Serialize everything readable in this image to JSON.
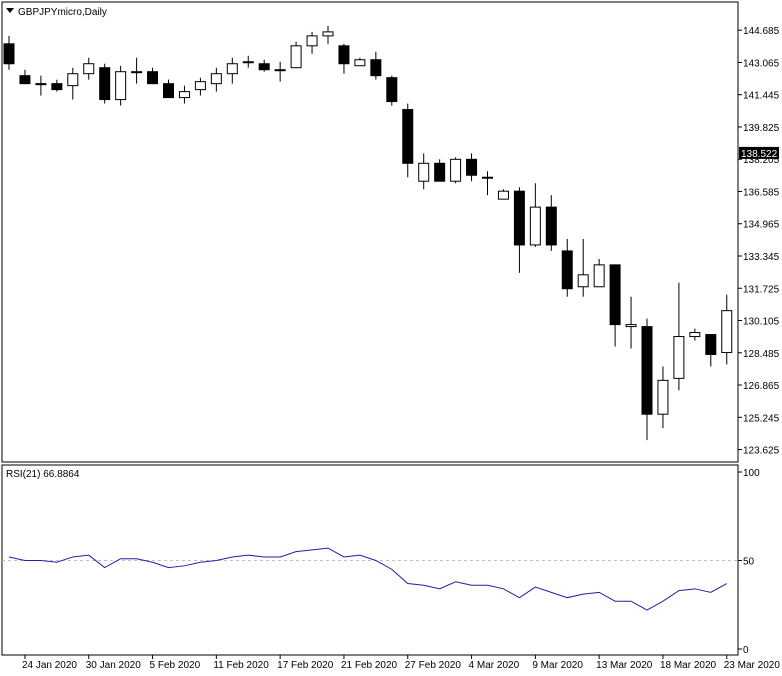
{
  "window": {
    "symbol_label": "GBPJPYmicro,Daily",
    "menu_arrow_icon": "triangle-down-icon"
  },
  "colors": {
    "background": "#ffffff",
    "frame": "#000000",
    "candle_bull_fill": "#ffffff",
    "candle_bear_fill": "#000000",
    "candle_outline": "#000000",
    "rsi_line": "#1f1fa8",
    "level_line": "#c0c0c0",
    "current_price_bg": "#000000",
    "current_price_text": "#ffffff"
  },
  "chart_data": [
    {
      "type": "candlestick",
      "title": "GBPJPYmicro,Daily",
      "ylim": [
        123.0,
        146.1
      ],
      "y_ticks": [
        "144.685",
        "143.065",
        "141.445",
        "139.825",
        "138.205",
        "136.585",
        "134.965",
        "133.345",
        "131.725",
        "130.105",
        "128.485",
        "126.865",
        "125.245",
        "123.625"
      ],
      "current_price": "138.522",
      "x_tick_labels": [
        "24 Jan 2020",
        "30 Jan 2020",
        "5 Feb 2020",
        "11 Feb 2020",
        "17 Feb 2020",
        "21 Feb 2020",
        "27 Feb 2020",
        "4 Mar 2020",
        "9 Mar 2020",
        "13 Mar 2020",
        "18 Mar 2020",
        "23 Mar 2020"
      ],
      "x_tick_indices": [
        1,
        5,
        9,
        13,
        17,
        21,
        25,
        29,
        33,
        37,
        41,
        45
      ],
      "candles": [
        {
          "o": 144.0,
          "h": 144.4,
          "l": 142.7,
          "c": 143.0
        },
        {
          "o": 142.4,
          "h": 142.7,
          "l": 142.0,
          "c": 142.0
        },
        {
          "o": 142.0,
          "h": 142.4,
          "l": 141.4,
          "c": 142.0
        },
        {
          "o": 142.0,
          "h": 142.2,
          "l": 141.6,
          "c": 141.7
        },
        {
          "o": 141.9,
          "h": 142.8,
          "l": 141.2,
          "c": 142.5
        },
        {
          "o": 142.5,
          "h": 143.3,
          "l": 142.2,
          "c": 143.0
        },
        {
          "o": 142.8,
          "h": 143.0,
          "l": 141.0,
          "c": 141.2
        },
        {
          "o": 141.2,
          "h": 142.9,
          "l": 140.9,
          "c": 142.6
        },
        {
          "o": 142.6,
          "h": 143.3,
          "l": 142.0,
          "c": 142.6
        },
        {
          "o": 142.6,
          "h": 142.8,
          "l": 142.0,
          "c": 142.0
        },
        {
          "o": 142.0,
          "h": 142.2,
          "l": 141.3,
          "c": 141.3
        },
        {
          "o": 141.3,
          "h": 141.9,
          "l": 141.0,
          "c": 141.6
        },
        {
          "o": 141.7,
          "h": 142.3,
          "l": 141.4,
          "c": 142.1
        },
        {
          "o": 142.0,
          "h": 142.8,
          "l": 141.6,
          "c": 142.5
        },
        {
          "o": 142.5,
          "h": 143.3,
          "l": 142.0,
          "c": 143.0
        },
        {
          "o": 143.1,
          "h": 143.4,
          "l": 142.8,
          "c": 143.1
        },
        {
          "o": 143.0,
          "h": 143.2,
          "l": 142.6,
          "c": 142.7
        },
        {
          "o": 142.7,
          "h": 143.1,
          "l": 142.1,
          "c": 142.7
        },
        {
          "o": 142.8,
          "h": 144.1,
          "l": 142.8,
          "c": 143.9
        },
        {
          "o": 143.9,
          "h": 144.6,
          "l": 143.5,
          "c": 144.4
        },
        {
          "o": 144.4,
          "h": 144.9,
          "l": 144.0,
          "c": 144.6
        },
        {
          "o": 143.9,
          "h": 144.0,
          "l": 142.5,
          "c": 143.0
        },
        {
          "o": 142.9,
          "h": 143.3,
          "l": 142.9,
          "c": 143.2
        },
        {
          "o": 143.2,
          "h": 143.6,
          "l": 142.2,
          "c": 142.4
        },
        {
          "o": 142.3,
          "h": 142.4,
          "l": 140.9,
          "c": 141.1
        },
        {
          "o": 140.7,
          "h": 141.0,
          "l": 137.3,
          "c": 138.0
        },
        {
          "o": 137.1,
          "h": 138.5,
          "l": 136.7,
          "c": 138.0
        },
        {
          "o": 138.0,
          "h": 138.2,
          "l": 137.1,
          "c": 137.1
        },
        {
          "o": 137.1,
          "h": 138.3,
          "l": 137.0,
          "c": 138.2
        },
        {
          "o": 138.2,
          "h": 138.5,
          "l": 137.1,
          "c": 137.4
        },
        {
          "o": 137.3,
          "h": 137.6,
          "l": 136.4,
          "c": 137.3
        },
        {
          "o": 136.2,
          "h": 136.7,
          "l": 136.2,
          "c": 136.6
        },
        {
          "o": 136.6,
          "h": 136.8,
          "l": 132.5,
          "c": 133.9
        },
        {
          "o": 133.9,
          "h": 137.0,
          "l": 133.8,
          "c": 135.8
        },
        {
          "o": 135.8,
          "h": 136.4,
          "l": 133.6,
          "c": 133.9
        },
        {
          "o": 133.6,
          "h": 134.2,
          "l": 131.3,
          "c": 131.7
        },
        {
          "o": 131.8,
          "h": 134.2,
          "l": 131.3,
          "c": 132.4
        },
        {
          "o": 131.8,
          "h": 133.2,
          "l": 131.8,
          "c": 132.9
        },
        {
          "o": 132.9,
          "h": 132.9,
          "l": 128.8,
          "c": 129.9
        },
        {
          "o": 129.8,
          "h": 131.3,
          "l": 128.7,
          "c": 129.9
        },
        {
          "o": 129.8,
          "h": 130.2,
          "l": 124.1,
          "c": 125.4
        },
        {
          "o": 125.4,
          "h": 127.8,
          "l": 124.7,
          "c": 127.1
        },
        {
          "o": 127.2,
          "h": 132.0,
          "l": 126.6,
          "c": 129.3
        },
        {
          "o": 129.3,
          "h": 129.7,
          "l": 129.1,
          "c": 129.5
        },
        {
          "o": 129.4,
          "h": 129.4,
          "l": 127.8,
          "c": 128.4
        },
        {
          "o": 128.5,
          "h": 131.4,
          "l": 127.9,
          "c": 130.6
        }
      ]
    },
    {
      "type": "line",
      "title": "RSI(21) 66.8864",
      "ylim": [
        0,
        100
      ],
      "y_ticks": [
        "100",
        "50",
        "0"
      ],
      "levels": [
        50
      ],
      "series": [
        {
          "values": [
            52,
            50,
            50,
            49,
            52,
            53,
            46,
            51,
            51,
            49,
            46,
            47,
            49,
            50,
            52,
            53,
            52,
            52,
            55,
            56,
            57,
            52,
            53,
            50,
            45,
            37,
            36,
            34,
            38,
            36,
            36,
            34,
            29,
            35,
            32,
            29,
            31,
            32,
            27,
            27,
            22,
            27,
            33,
            34,
            32,
            37
          ]
        }
      ]
    }
  ]
}
